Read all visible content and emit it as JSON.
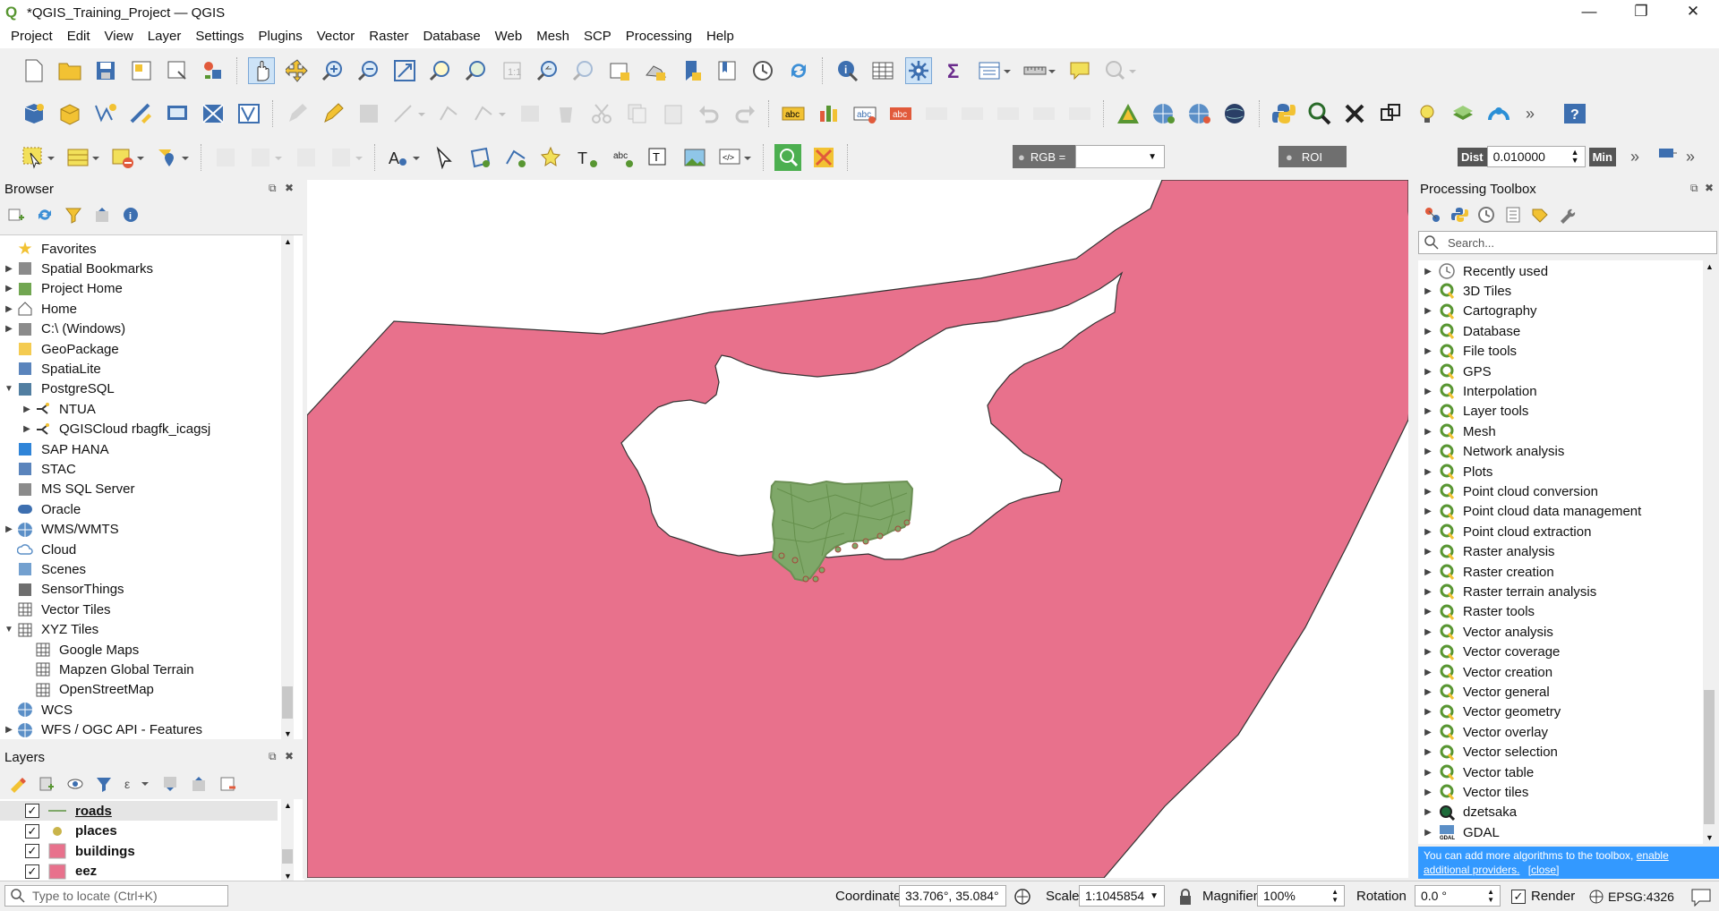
{
  "window": {
    "title": "*QGIS_Training_Project — QGIS"
  },
  "menu": [
    "Project",
    "Edit",
    "View",
    "Layer",
    "Settings",
    "Plugins",
    "Vector",
    "Raster",
    "Database",
    "Web",
    "Mesh",
    "SCP",
    "Processing",
    "Help"
  ],
  "toolbar3": {
    "rgb_label": "RGB =",
    "roi_label": "ROI",
    "dist_label": "Dist",
    "dist_value": "0.010000",
    "min_label": "Min"
  },
  "browser": {
    "title": "Browser",
    "items": [
      {
        "label": "Favorites",
        "icon": "star-icon",
        "expand": "",
        "indent": 0
      },
      {
        "label": "Spatial Bookmarks",
        "icon": "bookmark-icon",
        "expand": "▶",
        "indent": 0
      },
      {
        "label": "Project Home",
        "icon": "project-home-icon",
        "expand": "▶",
        "indent": 0
      },
      {
        "label": "Home",
        "icon": "home-icon",
        "expand": "▶",
        "indent": 0
      },
      {
        "label": "C:\\ (Windows)",
        "icon": "drive-icon",
        "expand": "▶",
        "indent": 0
      },
      {
        "label": "GeoPackage",
        "icon": "geopackage-icon",
        "expand": "",
        "indent": 0
      },
      {
        "label": "SpatiaLite",
        "icon": "spatialite-icon",
        "expand": "",
        "indent": 0
      },
      {
        "label": "PostgreSQL",
        "icon": "postgresql-icon",
        "expand": "▼",
        "indent": 0
      },
      {
        "label": "NTUA",
        "icon": "connection-icon",
        "expand": "▶",
        "indent": 1
      },
      {
        "label": "QGISCloud rbagfk_icagsj",
        "icon": "connection-icon",
        "expand": "▶",
        "indent": 1
      },
      {
        "label": "SAP HANA",
        "icon": "sap-hana-icon",
        "expand": "",
        "indent": 0
      },
      {
        "label": "STAC",
        "icon": "stac-icon",
        "expand": "",
        "indent": 0
      },
      {
        "label": "MS SQL Server",
        "icon": "mssql-icon",
        "expand": "",
        "indent": 0
      },
      {
        "label": "Oracle",
        "icon": "oracle-icon",
        "expand": "",
        "indent": 0
      },
      {
        "label": "WMS/WMTS",
        "icon": "globe-icon",
        "expand": "▶",
        "indent": 0
      },
      {
        "label": "Cloud",
        "icon": "cloud-icon",
        "expand": "",
        "indent": 0
      },
      {
        "label": "Scenes",
        "icon": "scenes-icon",
        "expand": "",
        "indent": 0
      },
      {
        "label": "SensorThings",
        "icon": "sensor-icon",
        "expand": "",
        "indent": 0
      },
      {
        "label": "Vector Tiles",
        "icon": "grid-icon",
        "expand": "",
        "indent": 0
      },
      {
        "label": "XYZ Tiles",
        "icon": "grid-icon",
        "expand": "▼",
        "indent": 0
      },
      {
        "label": "Google Maps",
        "icon": "grid-icon",
        "expand": "",
        "indent": 1
      },
      {
        "label": "Mapzen Global Terrain",
        "icon": "grid-icon",
        "expand": "",
        "indent": 1
      },
      {
        "label": "OpenStreetMap",
        "icon": "grid-icon",
        "expand": "",
        "indent": 1
      },
      {
        "label": "WCS",
        "icon": "globe-icon",
        "expand": "",
        "indent": 0
      },
      {
        "label": "WFS / OGC API - Features",
        "icon": "globe-icon",
        "expand": "▶",
        "indent": 0
      }
    ]
  },
  "layers": {
    "title": "Layers",
    "items": [
      {
        "label": "roads",
        "checked": true,
        "symbol": "line",
        "underline": true
      },
      {
        "label": "places",
        "checked": true,
        "symbol": "point",
        "underline": false
      },
      {
        "label": "buildings",
        "checked": true,
        "symbol": "fill",
        "underline": false
      },
      {
        "label": "eez",
        "checked": true,
        "symbol": "fill",
        "underline": false
      }
    ]
  },
  "toolbox": {
    "title": "Processing Toolbox",
    "search_placeholder": "Search...",
    "items": [
      {
        "label": "Recently used",
        "icon": "clock-icon"
      },
      {
        "label": "3D Tiles",
        "icon": "qgis-icon"
      },
      {
        "label": "Cartography",
        "icon": "qgis-icon"
      },
      {
        "label": "Database",
        "icon": "qgis-icon"
      },
      {
        "label": "File tools",
        "icon": "qgis-icon"
      },
      {
        "label": "GPS",
        "icon": "qgis-icon"
      },
      {
        "label": "Interpolation",
        "icon": "qgis-icon"
      },
      {
        "label": "Layer tools",
        "icon": "qgis-icon"
      },
      {
        "label": "Mesh",
        "icon": "qgis-icon"
      },
      {
        "label": "Network analysis",
        "icon": "qgis-icon"
      },
      {
        "label": "Plots",
        "icon": "qgis-icon"
      },
      {
        "label": "Point cloud conversion",
        "icon": "qgis-icon"
      },
      {
        "label": "Point cloud data management",
        "icon": "qgis-icon"
      },
      {
        "label": "Point cloud extraction",
        "icon": "qgis-icon"
      },
      {
        "label": "Raster analysis",
        "icon": "qgis-icon"
      },
      {
        "label": "Raster creation",
        "icon": "qgis-icon"
      },
      {
        "label": "Raster terrain analysis",
        "icon": "qgis-icon"
      },
      {
        "label": "Raster tools",
        "icon": "qgis-icon"
      },
      {
        "label": "Vector analysis",
        "icon": "qgis-icon"
      },
      {
        "label": "Vector coverage",
        "icon": "qgis-icon"
      },
      {
        "label": "Vector creation",
        "icon": "qgis-icon"
      },
      {
        "label": "Vector general",
        "icon": "qgis-icon"
      },
      {
        "label": "Vector geometry",
        "icon": "qgis-icon"
      },
      {
        "label": "Vector overlay",
        "icon": "qgis-icon"
      },
      {
        "label": "Vector selection",
        "icon": "qgis-icon"
      },
      {
        "label": "Vector table",
        "icon": "qgis-icon"
      },
      {
        "label": "Vector tiles",
        "icon": "qgis-icon"
      },
      {
        "label": "dzetsaka",
        "icon": "dzetsaka-icon"
      },
      {
        "label": "GDAL",
        "icon": "gdal-icon"
      }
    ],
    "notice_text": "You can add more algorithms to the toolbox,",
    "notice_link": "enable additional providers.",
    "notice_close": "[close]"
  },
  "status": {
    "locate_placeholder": "Type to locate (Ctrl+K)",
    "coordinate_label": "Coordinate",
    "coordinate_value": "33.706°, 35.084°",
    "scale_label": "Scale",
    "scale_value": "1:1045854",
    "magnifier_label": "Magnifier",
    "magnifier_value": "100%",
    "rotation_label": "Rotation",
    "rotation_value": "0.0 °",
    "render_label": "Render",
    "crs_label": "EPSG:4326"
  },
  "colors": {
    "eez_fill": "#e8718c",
    "buildings_fill": "#7fa869",
    "accent": "#0078d7",
    "notice_bg": "#3399ff"
  }
}
